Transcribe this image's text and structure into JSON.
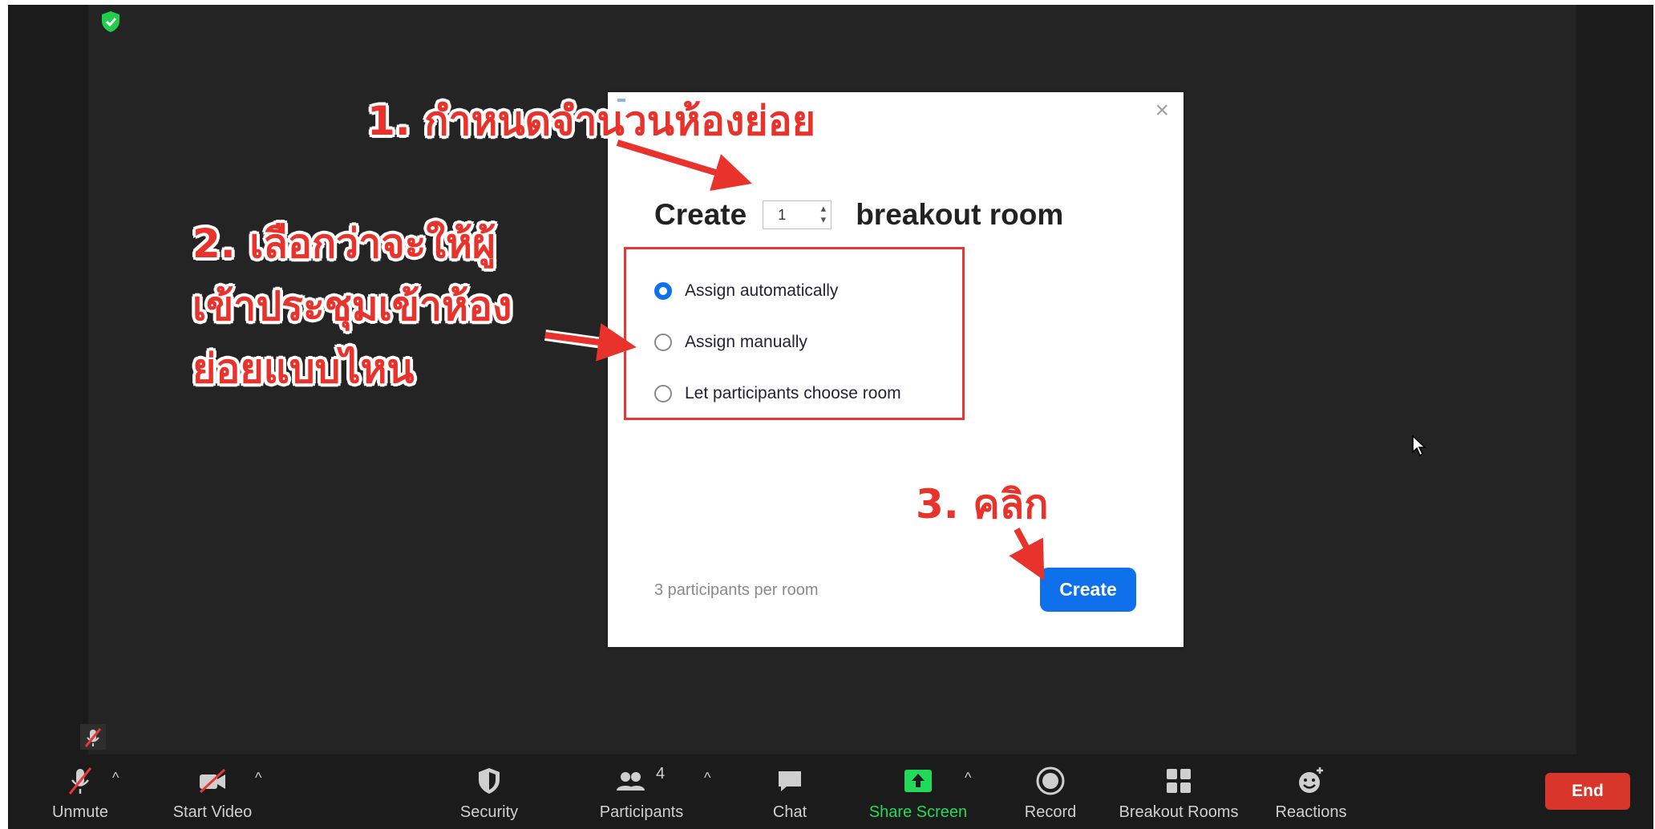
{
  "dialog": {
    "close_glyph": "×",
    "create_word": "Create",
    "room_count": "1",
    "room_word": "breakout room",
    "options": [
      {
        "label": "Assign automatically",
        "checked": true
      },
      {
        "label": "Assign manually",
        "checked": false
      },
      {
        "label": "Let participants choose room",
        "checked": false
      }
    ],
    "per_room": "3 participants per room",
    "create_button": "Create"
  },
  "annotations": {
    "step1": "1. กำหนดจำนวนห้องย่อย",
    "step2_line1": "2. เลือกว่าจะให้ผู้",
    "step2_line2": "เข้าประชุมเข้าห้อง",
    "step2_line3": "ย่อยแบบไหน",
    "step3": "3. คลิก"
  },
  "toolbar": {
    "unmute": "Unmute",
    "start_video": "Start Video",
    "security": "Security",
    "participants": "Participants",
    "participants_count": "4",
    "chat": "Chat",
    "share_screen": "Share Screen",
    "record": "Record",
    "breakout_rooms": "Breakout Rooms",
    "reactions": "Reactions",
    "end": "End",
    "caret": "^"
  },
  "colors": {
    "accent_blue": "#0e71eb",
    "share_green": "#23d959",
    "end_red": "#d9362b",
    "annotation_red": "#e8332c",
    "shield_green": "#1fcf4b"
  }
}
